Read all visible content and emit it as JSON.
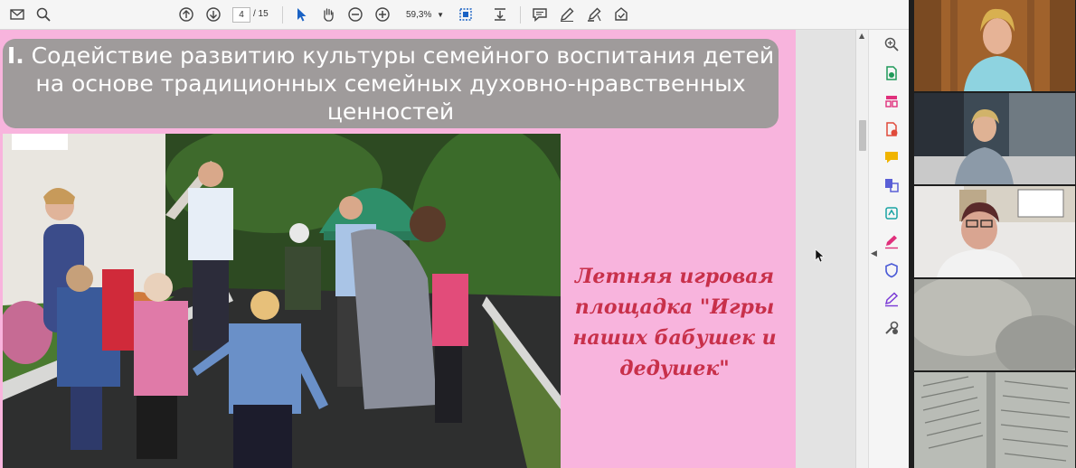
{
  "toolbar": {
    "page_current": "4",
    "page_total": "/ 15",
    "zoom": "59,3%",
    "icons": [
      "mail-icon",
      "zoom-search-icon",
      "page-up-icon",
      "page-down-icon",
      "select-arrow-icon",
      "hand-icon",
      "zoom-out-icon",
      "zoom-in-icon",
      "fit-page-icon",
      "scroll-mode-icon",
      "comment-icon",
      "pen-icon",
      "highlight-icon",
      "stamp-icon"
    ]
  },
  "slide": {
    "title_number": "I.",
    "title_text": " Содействие развитию культуры семейного воспитания детей на основе традиционных семейных духовно-нравственных ценностей",
    "caption": "Летняя игровая площадка \"Игры наших бабушек и дедушек\"",
    "background_color": "#f8b4dd",
    "title_box_color": "#9f9b9b",
    "caption_color": "#c8304a"
  },
  "right_tools": [
    "zoom-icon",
    "export-pdf-icon",
    "organize-pages-icon",
    "edit-pdf-icon",
    "comment-icon",
    "combine-files-icon",
    "scan-icon",
    "fill-sign-icon",
    "protect-icon",
    "sign-icon",
    "more-tools-icon"
  ],
  "video_panel": {
    "participants": 5
  }
}
